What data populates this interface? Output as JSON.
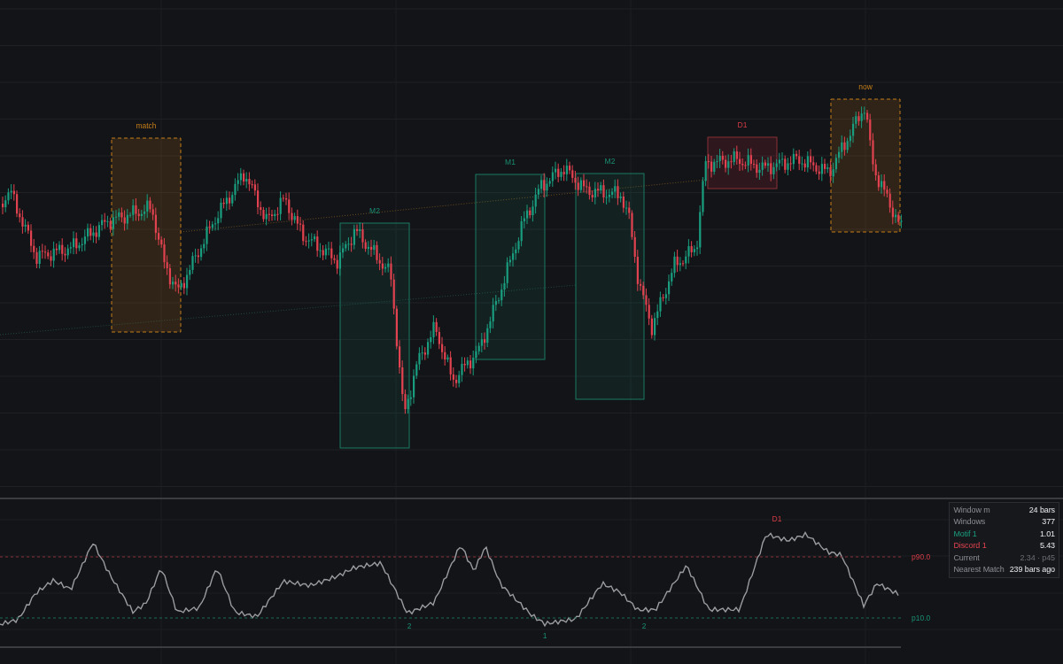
{
  "regions": [
    {
      "kind": "match",
      "label": "match"
    },
    {
      "kind": "motif",
      "label": "M2"
    },
    {
      "kind": "motif",
      "label": "M1"
    },
    {
      "kind": "motif",
      "label": "M2"
    },
    {
      "kind": "discord",
      "label": "D1"
    },
    {
      "kind": "current",
      "label": "now"
    }
  ],
  "profile": {
    "thresholds": [
      {
        "kind": "high",
        "label": "p90.0"
      },
      {
        "kind": "low",
        "label": "p10.0"
      }
    ],
    "markers": [
      {
        "kind": "discord",
        "label": "D1"
      },
      {
        "kind": "motif",
        "label": "2"
      },
      {
        "kind": "motif",
        "label": "1"
      },
      {
        "kind": "motif",
        "label": "2"
      }
    ]
  },
  "stats": [
    {
      "kind": "plain",
      "label": "Window m",
      "value": "24 bars"
    },
    {
      "kind": "plain",
      "label": "Windows",
      "value": "377"
    },
    {
      "kind": "motif",
      "label": "Motif 1",
      "value": "1.01"
    },
    {
      "kind": "discord",
      "label": "Discord 1",
      "value": "5.43"
    },
    {
      "kind": "muted",
      "label": "Current",
      "value": "2.34 · p45"
    },
    {
      "kind": "plain",
      "label": "Nearest Match",
      "value": "239 bars ago"
    }
  ]
}
